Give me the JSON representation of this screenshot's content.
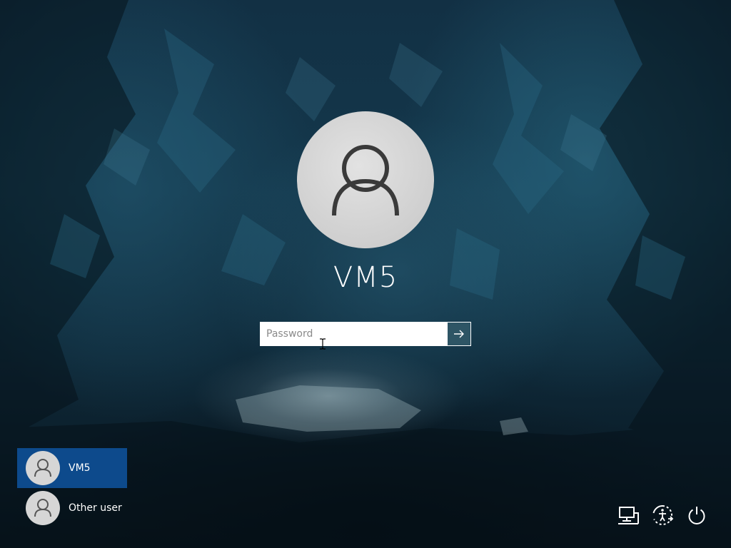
{
  "login": {
    "user_name": "VM5",
    "password_placeholder": "Password",
    "password_value": "",
    "submit_icon": "arrow-right-icon"
  },
  "user_switcher": {
    "users": [
      {
        "label": "VM5",
        "selected": true,
        "icon": "user-icon"
      },
      {
        "label": "Other user",
        "selected": false,
        "icon": "user-icon"
      }
    ]
  },
  "corner_buttons": [
    {
      "icon": "network-icon"
    },
    {
      "icon": "ease-of-access-icon"
    },
    {
      "icon": "power-icon"
    }
  ],
  "colors": {
    "selected_tile": "#0d4a8c",
    "submit_button": "#2e5565",
    "avatar": "#d6d6d6"
  }
}
